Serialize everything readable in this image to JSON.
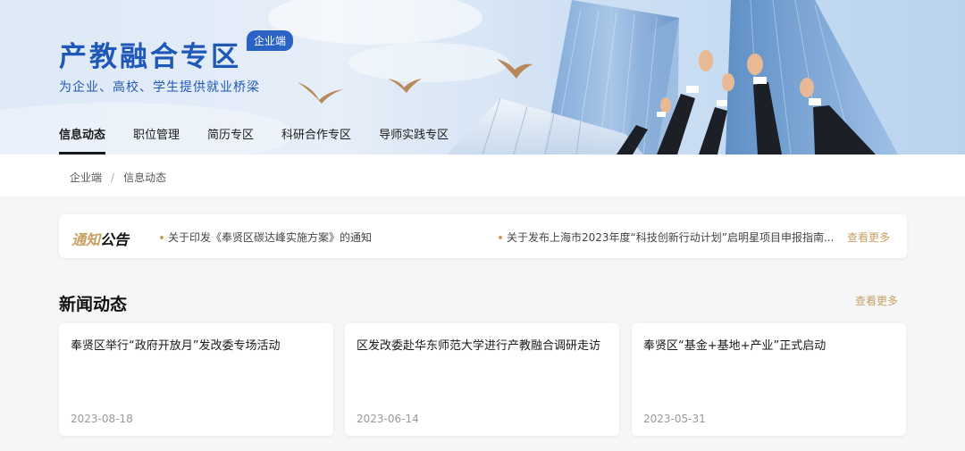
{
  "brand": {
    "title": "产教融合专区",
    "badge": "企业端",
    "subtitle": "为企业、高校、学生提供就业桥梁"
  },
  "nav": [
    {
      "label": "信息动态",
      "active": true
    },
    {
      "label": "职位管理",
      "active": false
    },
    {
      "label": "简历专区",
      "active": false
    },
    {
      "label": "科研合作专区",
      "active": false
    },
    {
      "label": "导师实践专区",
      "active": false
    }
  ],
  "breadcrumb": {
    "items": [
      "企业端",
      "信息动态"
    ],
    "separator": "/"
  },
  "notice": {
    "label_highlight": "通知",
    "label_rest": "公告",
    "items": [
      "关于印发《奉贤区碳达峰实施方案》的通知",
      "关于发布上海市2023年度“科技创新行动计划”启明星项目申报指南..."
    ],
    "more": "查看更多"
  },
  "news": {
    "title": "新闻动态",
    "more": "查看更多",
    "cards": [
      {
        "title": "奉贤区举行“政府开放月”发改委专场活动",
        "date": "2023-08-18"
      },
      {
        "title": "区发改委赴华东师范大学进行产教融合调研走访",
        "date": "2023-06-14"
      },
      {
        "title": "奉贤区“基金+基地+产业”正式启动",
        "date": "2023-05-31"
      }
    ]
  },
  "colors": {
    "brand_blue": "#1f58b8",
    "accent_gold": "#c9a063",
    "page_bg": "#f5f6f8"
  }
}
